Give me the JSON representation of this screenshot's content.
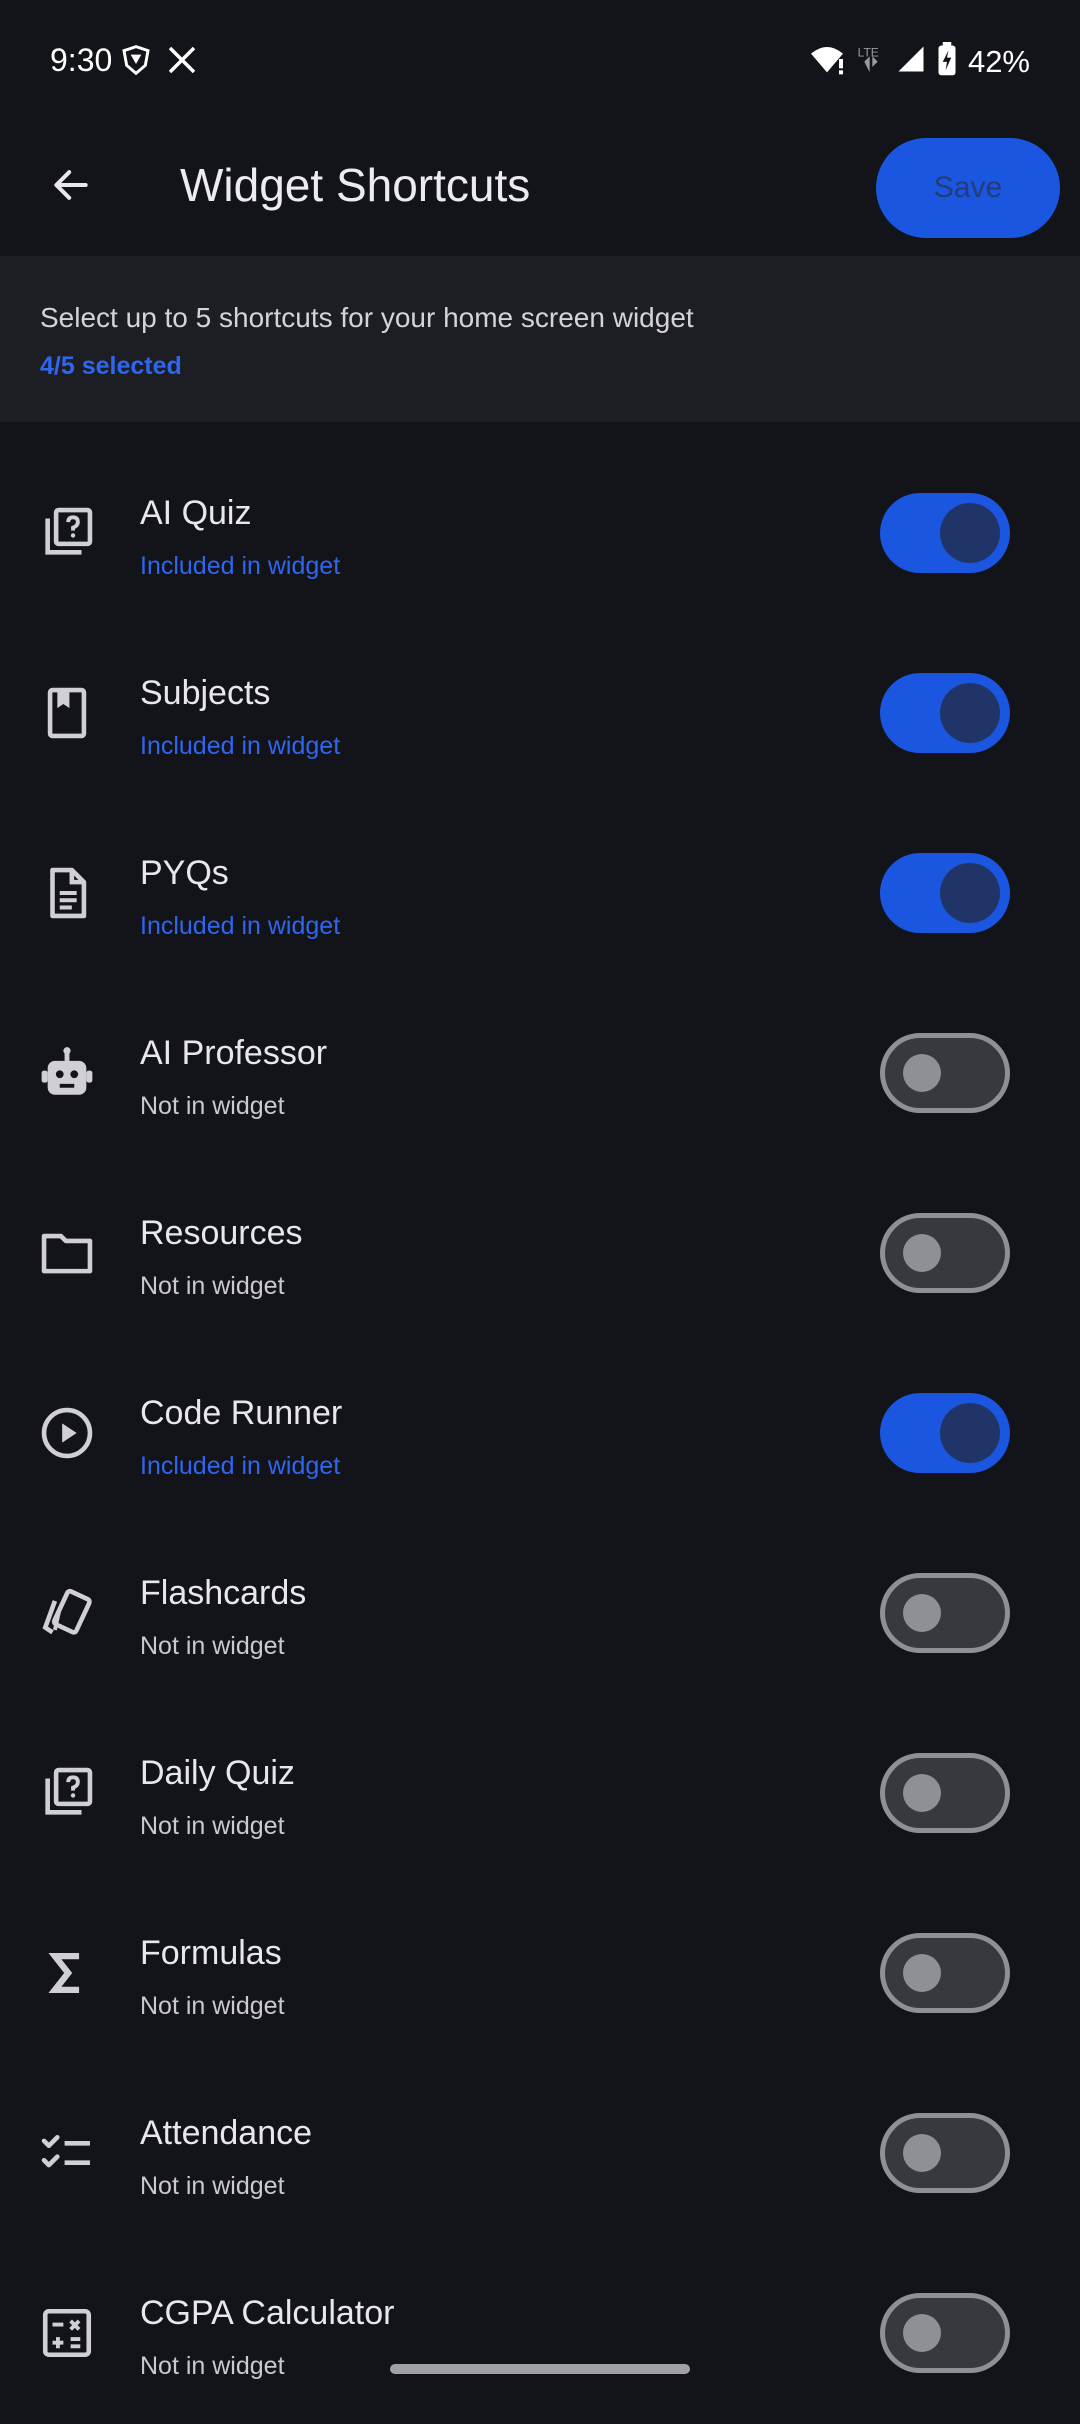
{
  "status_bar": {
    "time": "9:30",
    "battery": "42%",
    "left_icons": [
      "shield-notification-icon",
      "x-app-icon"
    ],
    "right_icons": [
      "wifi-icon",
      "lte-icon",
      "signal-icon",
      "battery-charging-icon"
    ]
  },
  "app_bar": {
    "title": "Widget Shortcuts",
    "save_label": "Save"
  },
  "info": {
    "description": "Select up to 5 shortcuts for your home screen widget",
    "count": "4/5 selected"
  },
  "shortcuts": [
    {
      "title": "AI Quiz",
      "subtitle": "Included in widget",
      "enabled": true,
      "icon": "quiz-icon"
    },
    {
      "title": "Subjects",
      "subtitle": "Included in widget",
      "enabled": true,
      "icon": "bookmark-book-icon"
    },
    {
      "title": "PYQs",
      "subtitle": "Included in widget",
      "enabled": true,
      "icon": "document-icon"
    },
    {
      "title": "AI Professor",
      "subtitle": "Not in widget",
      "enabled": false,
      "icon": "robot-icon"
    },
    {
      "title": "Resources",
      "subtitle": "Not in widget",
      "enabled": false,
      "icon": "folder-icon"
    },
    {
      "title": "Code Runner",
      "subtitle": "Included in widget",
      "enabled": true,
      "icon": "play-circle-icon"
    },
    {
      "title": "Flashcards",
      "subtitle": "Not in widget",
      "enabled": false,
      "icon": "flashcards-icon"
    },
    {
      "title": "Daily Quiz",
      "subtitle": "Not in widget",
      "enabled": false,
      "icon": "quiz-icon"
    },
    {
      "title": "Formulas",
      "subtitle": "Not in widget",
      "enabled": false,
      "icon": "sigma-icon"
    },
    {
      "title": "Attendance",
      "subtitle": "Not in widget",
      "enabled": false,
      "icon": "checklist-icon"
    },
    {
      "title": "CGPA Calculator",
      "subtitle": "Not in widget",
      "enabled": false,
      "icon": "calculator-icon"
    }
  ],
  "colors": {
    "background": "#13141a",
    "accent": "#1a56e0",
    "accent_text": "#2f66ef"
  }
}
